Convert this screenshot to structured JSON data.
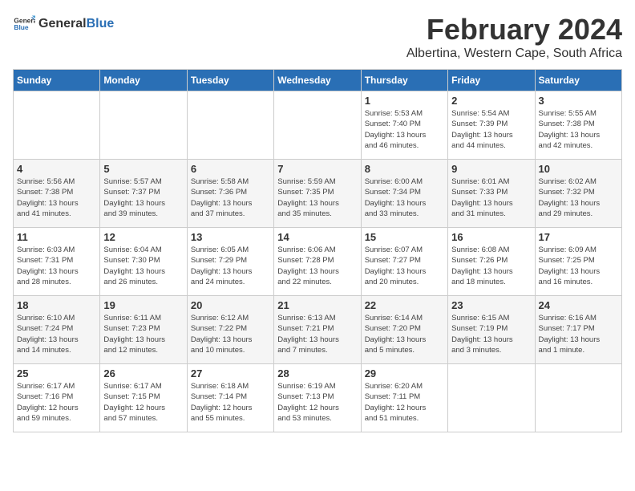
{
  "header": {
    "logo_general": "General",
    "logo_blue": "Blue",
    "title": "February 2024",
    "location": "Albertina, Western Cape, South Africa"
  },
  "days_of_week": [
    "Sunday",
    "Monday",
    "Tuesday",
    "Wednesday",
    "Thursday",
    "Friday",
    "Saturday"
  ],
  "weeks": [
    [
      {
        "day": "",
        "info": ""
      },
      {
        "day": "",
        "info": ""
      },
      {
        "day": "",
        "info": ""
      },
      {
        "day": "",
        "info": ""
      },
      {
        "day": "1",
        "info": "Sunrise: 5:53 AM\nSunset: 7:40 PM\nDaylight: 13 hours\nand 46 minutes."
      },
      {
        "day": "2",
        "info": "Sunrise: 5:54 AM\nSunset: 7:39 PM\nDaylight: 13 hours\nand 44 minutes."
      },
      {
        "day": "3",
        "info": "Sunrise: 5:55 AM\nSunset: 7:38 PM\nDaylight: 13 hours\nand 42 minutes."
      }
    ],
    [
      {
        "day": "4",
        "info": "Sunrise: 5:56 AM\nSunset: 7:38 PM\nDaylight: 13 hours\nand 41 minutes."
      },
      {
        "day": "5",
        "info": "Sunrise: 5:57 AM\nSunset: 7:37 PM\nDaylight: 13 hours\nand 39 minutes."
      },
      {
        "day": "6",
        "info": "Sunrise: 5:58 AM\nSunset: 7:36 PM\nDaylight: 13 hours\nand 37 minutes."
      },
      {
        "day": "7",
        "info": "Sunrise: 5:59 AM\nSunset: 7:35 PM\nDaylight: 13 hours\nand 35 minutes."
      },
      {
        "day": "8",
        "info": "Sunrise: 6:00 AM\nSunset: 7:34 PM\nDaylight: 13 hours\nand 33 minutes."
      },
      {
        "day": "9",
        "info": "Sunrise: 6:01 AM\nSunset: 7:33 PM\nDaylight: 13 hours\nand 31 minutes."
      },
      {
        "day": "10",
        "info": "Sunrise: 6:02 AM\nSunset: 7:32 PM\nDaylight: 13 hours\nand 29 minutes."
      }
    ],
    [
      {
        "day": "11",
        "info": "Sunrise: 6:03 AM\nSunset: 7:31 PM\nDaylight: 13 hours\nand 28 minutes."
      },
      {
        "day": "12",
        "info": "Sunrise: 6:04 AM\nSunset: 7:30 PM\nDaylight: 13 hours\nand 26 minutes."
      },
      {
        "day": "13",
        "info": "Sunrise: 6:05 AM\nSunset: 7:29 PM\nDaylight: 13 hours\nand 24 minutes."
      },
      {
        "day": "14",
        "info": "Sunrise: 6:06 AM\nSunset: 7:28 PM\nDaylight: 13 hours\nand 22 minutes."
      },
      {
        "day": "15",
        "info": "Sunrise: 6:07 AM\nSunset: 7:27 PM\nDaylight: 13 hours\nand 20 minutes."
      },
      {
        "day": "16",
        "info": "Sunrise: 6:08 AM\nSunset: 7:26 PM\nDaylight: 13 hours\nand 18 minutes."
      },
      {
        "day": "17",
        "info": "Sunrise: 6:09 AM\nSunset: 7:25 PM\nDaylight: 13 hours\nand 16 minutes."
      }
    ],
    [
      {
        "day": "18",
        "info": "Sunrise: 6:10 AM\nSunset: 7:24 PM\nDaylight: 13 hours\nand 14 minutes."
      },
      {
        "day": "19",
        "info": "Sunrise: 6:11 AM\nSunset: 7:23 PM\nDaylight: 13 hours\nand 12 minutes."
      },
      {
        "day": "20",
        "info": "Sunrise: 6:12 AM\nSunset: 7:22 PM\nDaylight: 13 hours\nand 10 minutes."
      },
      {
        "day": "21",
        "info": "Sunrise: 6:13 AM\nSunset: 7:21 PM\nDaylight: 13 hours\nand 7 minutes."
      },
      {
        "day": "22",
        "info": "Sunrise: 6:14 AM\nSunset: 7:20 PM\nDaylight: 13 hours\nand 5 minutes."
      },
      {
        "day": "23",
        "info": "Sunrise: 6:15 AM\nSunset: 7:19 PM\nDaylight: 13 hours\nand 3 minutes."
      },
      {
        "day": "24",
        "info": "Sunrise: 6:16 AM\nSunset: 7:17 PM\nDaylight: 13 hours\nand 1 minute."
      }
    ],
    [
      {
        "day": "25",
        "info": "Sunrise: 6:17 AM\nSunset: 7:16 PM\nDaylight: 12 hours\nand 59 minutes."
      },
      {
        "day": "26",
        "info": "Sunrise: 6:17 AM\nSunset: 7:15 PM\nDaylight: 12 hours\nand 57 minutes."
      },
      {
        "day": "27",
        "info": "Sunrise: 6:18 AM\nSunset: 7:14 PM\nDaylight: 12 hours\nand 55 minutes."
      },
      {
        "day": "28",
        "info": "Sunrise: 6:19 AM\nSunset: 7:13 PM\nDaylight: 12 hours\nand 53 minutes."
      },
      {
        "day": "29",
        "info": "Sunrise: 6:20 AM\nSunset: 7:11 PM\nDaylight: 12 hours\nand 51 minutes."
      },
      {
        "day": "",
        "info": ""
      },
      {
        "day": "",
        "info": ""
      }
    ]
  ]
}
